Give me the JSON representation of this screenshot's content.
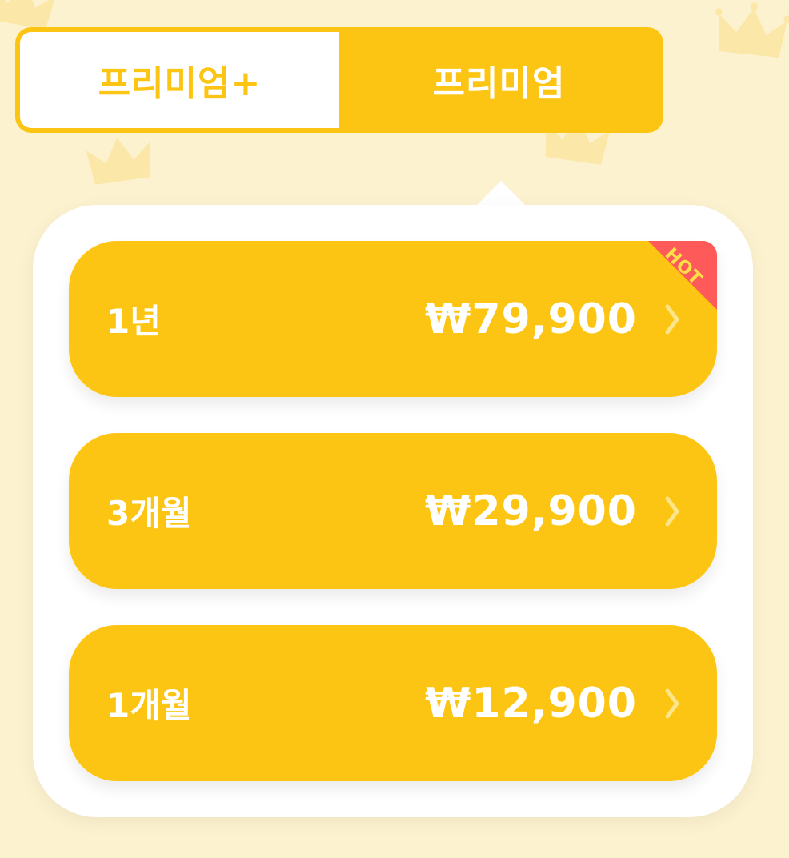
{
  "tabs": [
    {
      "label": "프리미엄+",
      "selected": true
    },
    {
      "label": "프리미엄",
      "selected": false
    }
  ],
  "plans": [
    {
      "duration": "1년",
      "price": "₩79,900",
      "badge": "HOT",
      "chevron_icon": "chevron-right-icon"
    },
    {
      "duration": "3개월",
      "price": "₩29,900",
      "chevron_icon": "chevron-right-icon"
    },
    {
      "duration": "1개월",
      "price": "₩12,900",
      "chevron_icon": "chevron-right-icon"
    }
  ],
  "colors": {
    "accent": "#fdc513",
    "background": "#fdf2cf",
    "card": "#ffffff",
    "badge": "#ff5a5a",
    "badge_text": "#fde047"
  },
  "decorations": [
    "crown-icon"
  ]
}
